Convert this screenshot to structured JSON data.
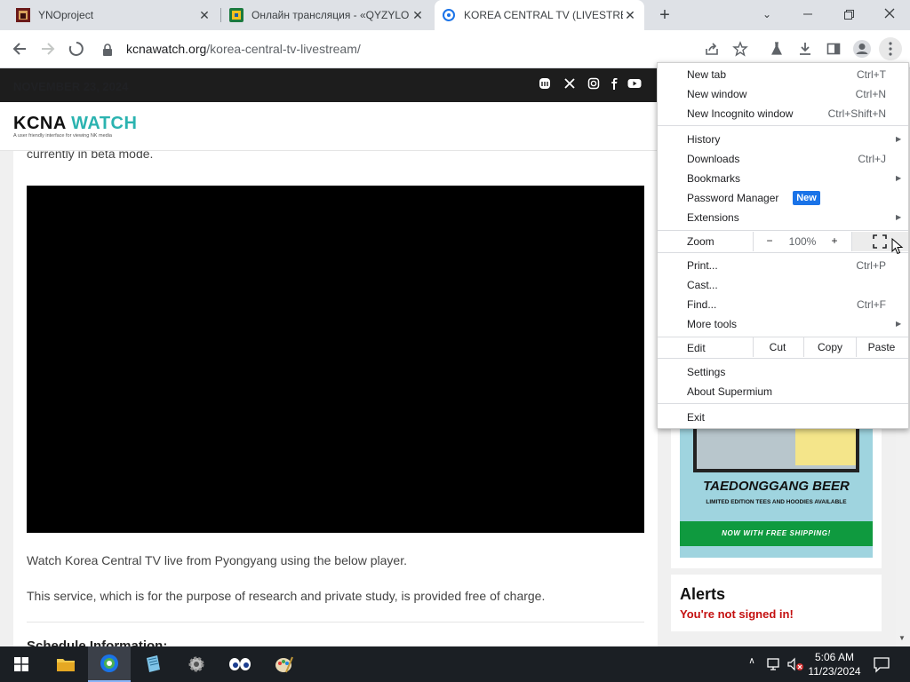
{
  "browser": {
    "tabs": [
      {
        "title": "YNOproject",
        "active": false
      },
      {
        "title": "Онлайн трансляция - «QYZYLO",
        "active": false
      },
      {
        "title": "KOREA CENTRAL TV (LIVESTREA",
        "active": true
      }
    ],
    "url_host": "kcnawatch.org",
    "url_path": "/korea-central-tv-livestream/"
  },
  "site": {
    "date": "NOVEMBER 23, 2024",
    "social_icons": [
      "mastodon-icon",
      "x-icon",
      "instagram-icon",
      "facebook-icon",
      "youtube-icon"
    ],
    "logo_prefix": "KCNA ",
    "logo_suffix": "WATCH",
    "logo_tagline": "A user friendly interface for viewing NK media",
    "beta_text": "currently in beta mode.",
    "para1": "Watch Korea Central TV live from Pyongyang using the below player.",
    "para2": "This service, which is for the purpose of research and private study, is provided free of charge.",
    "schedule_heading": "Schedule Information:",
    "ad_title": "TAEDONGGANG BEER",
    "ad_subtitle": "LIMITED EDITION TEES AND HOODIES AVAILABLE",
    "ad_cta": "NOW WITH FREE SHIPPING!",
    "alerts_title": "Alerts",
    "alerts_signin": "You're not signed in!"
  },
  "menu": {
    "new_tab": {
      "label": "New tab",
      "shortcut": "Ctrl+T"
    },
    "new_window": {
      "label": "New window",
      "shortcut": "Ctrl+N"
    },
    "incognito": {
      "label": "New Incognito window",
      "shortcut": "Ctrl+Shift+N"
    },
    "history": "History",
    "downloads": {
      "label": "Downloads",
      "shortcut": "Ctrl+J"
    },
    "bookmarks": "Bookmarks",
    "password_manager": "Password Manager",
    "new_badge": "New",
    "extensions": "Extensions",
    "zoom_label": "Zoom",
    "zoom_minus": "−",
    "zoom_value": "100%",
    "zoom_plus": "+",
    "print": {
      "label": "Print...",
      "shortcut": "Ctrl+P"
    },
    "cast": "Cast...",
    "find": {
      "label": "Find...",
      "shortcut": "Ctrl+F"
    },
    "more_tools": "More tools",
    "edit": "Edit",
    "cut": "Cut",
    "copy": "Copy",
    "paste": "Paste",
    "settings": "Settings",
    "about": "About Supermium",
    "exit": "Exit"
  },
  "taskbar": {
    "time": "5:06 AM",
    "date": "11/23/2024"
  },
  "colors": {
    "accent_teal": "#2bb3b0",
    "alert_red": "#c41010",
    "badge_blue": "#1a73e8",
    "ad_green": "#0f9a3f"
  }
}
